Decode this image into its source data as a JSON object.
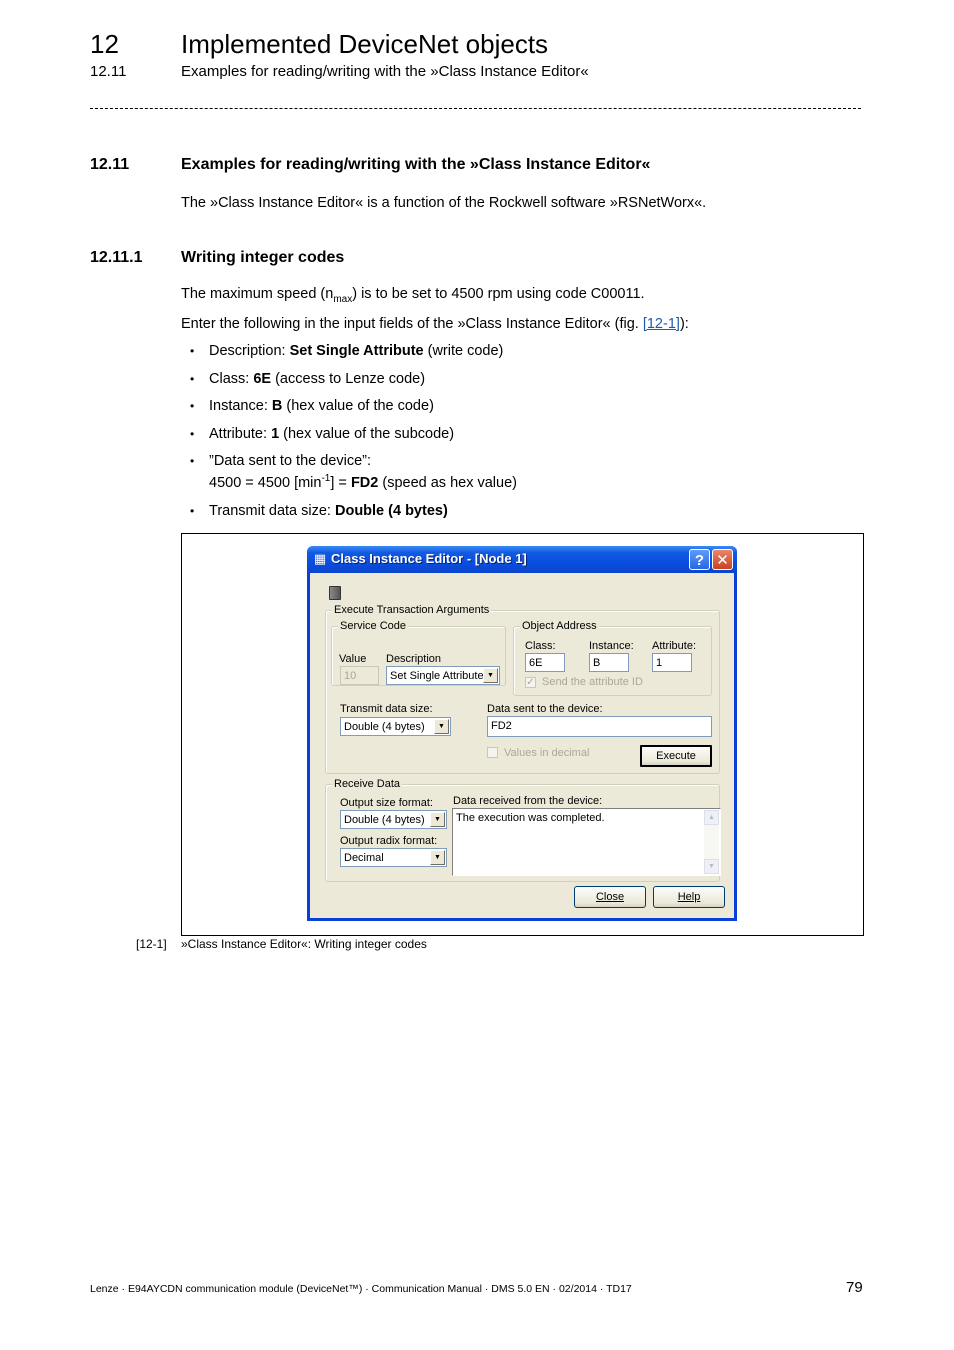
{
  "header": {
    "chapter_number": "12",
    "chapter_title": "Implemented DeviceNet objects",
    "section_number": "12.11",
    "section_title": "Examples for reading/writing with the »Class Instance Editor«"
  },
  "section": {
    "number": "12.11",
    "title": "Examples for reading/writing with the »Class Instance Editor«",
    "intro": "The »Class Instance Editor« is a function of the Rockwell software »RSNetWorx«."
  },
  "subsection": {
    "number": "12.11.1",
    "title": "Writing integer codes",
    "para1_pre": "The maximum speed (n",
    "para1_sub": "max",
    "para1_post": ") is to be set to 4500 rpm using code C00011.",
    "para2_pre": "Enter the following in the input fields of the »Class Instance Editor« (fig. ",
    "para2_link": "[12-1]",
    "para2_post": "):",
    "bullets": [
      {
        "label": "Description: ",
        "bold": "Set Single Attribute",
        "rest": " (write code)"
      },
      {
        "label": "Class: ",
        "bold": "6E",
        "rest": " (access to Lenze code)"
      },
      {
        "label": "Instance: ",
        "bold": "B",
        "rest": " (hex value of the code)"
      },
      {
        "label": "Attribute: ",
        "bold": "1",
        "rest": " (hex value of the subcode)"
      },
      {
        "label": "”Data sent to the device”:",
        "line2_pre": "4500 = 4500 [min",
        "line2_sup": "-1",
        "line2_mid": "] = ",
        "bold": "FD2",
        "rest": " (speed as hex value)"
      },
      {
        "label": "Transmit data size: ",
        "bold": "Double (4 bytes)",
        "rest": ""
      }
    ]
  },
  "dialog": {
    "title": "Class Instance Editor - [Node 1]",
    "help_button": "?",
    "close_button": "✕",
    "execute_group": "Execute Transaction Arguments",
    "service_code_group": "Service Code",
    "value_label": "Value",
    "value_field": "10",
    "description_label": "Description",
    "description_value": "Set Single Attribute",
    "object_address_group": "Object Address",
    "class_label": "Class:",
    "class_value": "6E",
    "instance_label": "Instance:",
    "instance_value": "B",
    "attribute_label": "Attribute:",
    "attribute_value": "1",
    "send_attr_id_label": "Send the attribute ID",
    "send_attr_id_checked": true,
    "transmit_size_label": "Transmit data size:",
    "transmit_size_value": "Double (4 bytes)",
    "data_sent_label": "Data sent to the device:",
    "data_sent_value": "FD2",
    "values_decimal_label": "Values in decimal",
    "values_decimal_checked": false,
    "execute_button": "Execute",
    "receive_group": "Receive Data",
    "output_size_label": "Output size format:",
    "output_size_value": "Double (4 bytes)",
    "output_radix_label": "Output radix format:",
    "output_radix_value": "Decimal",
    "data_received_label": "Data received from the device:",
    "data_received_value": "The execution was completed.",
    "close_label": "Close",
    "help_label": "Help"
  },
  "figure": {
    "number": "[12-1]",
    "caption": "»Class Instance Editor«: Writing integer codes"
  },
  "footer": {
    "text": "Lenze · E94AYCDN communication module (DeviceNet™) · Communication Manual · DMS 5.0 EN · 02/2014 · TD17",
    "page_number": "79"
  }
}
